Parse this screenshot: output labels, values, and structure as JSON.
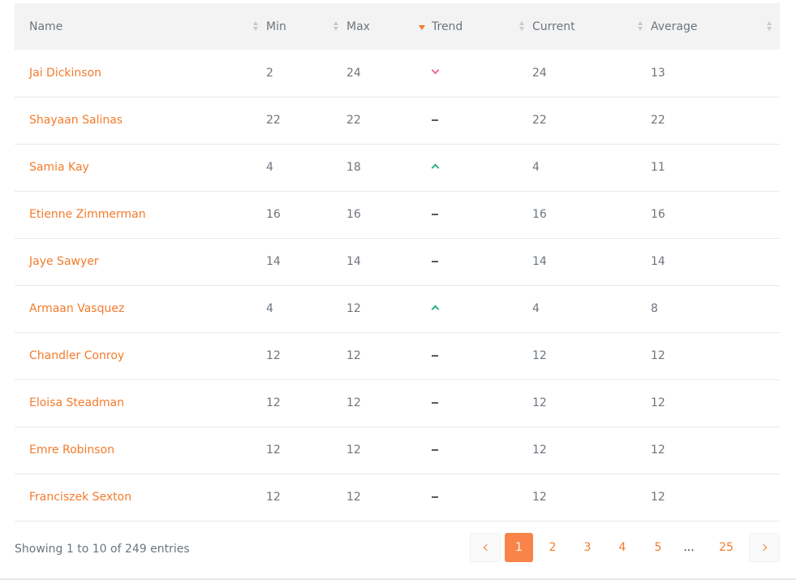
{
  "table": {
    "columns": [
      {
        "label": "Name",
        "sort": "none"
      },
      {
        "label": "Min",
        "sort": "none"
      },
      {
        "label": "Max",
        "sort": "desc"
      },
      {
        "label": "Trend",
        "sort": "none"
      },
      {
        "label": "Current",
        "sort": "none"
      },
      {
        "label": "Average",
        "sort": "none"
      }
    ],
    "rows": [
      {
        "name": "Jai Dickinson",
        "min": "2",
        "max": "24",
        "trend": "down",
        "current": "24",
        "average": "13"
      },
      {
        "name": "Shayaan Salinas",
        "min": "22",
        "max": "22",
        "trend": "flat",
        "current": "22",
        "average": "22"
      },
      {
        "name": "Samia Kay",
        "min": "4",
        "max": "18",
        "trend": "up",
        "current": "4",
        "average": "11"
      },
      {
        "name": "Etienne Zimmerman",
        "min": "16",
        "max": "16",
        "trend": "flat",
        "current": "16",
        "average": "16"
      },
      {
        "name": "Jaye Sawyer",
        "min": "14",
        "max": "14",
        "trend": "flat",
        "current": "14",
        "average": "14"
      },
      {
        "name": "Armaan Vasquez",
        "min": "4",
        "max": "12",
        "trend": "up",
        "current": "4",
        "average": "8"
      },
      {
        "name": "Chandler Conroy",
        "min": "12",
        "max": "12",
        "trend": "flat",
        "current": "12",
        "average": "12"
      },
      {
        "name": "Eloisa Steadman",
        "min": "12",
        "max": "12",
        "trend": "flat",
        "current": "12",
        "average": "12"
      },
      {
        "name": "Emre Robinson",
        "min": "12",
        "max": "12",
        "trend": "flat",
        "current": "12",
        "average": "12"
      },
      {
        "name": "Franciszek Sexton",
        "min": "12",
        "max": "12",
        "trend": "flat",
        "current": "12",
        "average": "12"
      }
    ]
  },
  "footer": {
    "info": "Showing 1 to 10 of 249 entries"
  },
  "pagination": {
    "prev_icon": "chevron-left-icon",
    "next_icon": "chevron-right-icon",
    "pages": [
      "1",
      "2",
      "3",
      "4",
      "5"
    ],
    "current": "1",
    "ellipsis": "...",
    "last": "25"
  },
  "colors": {
    "accent": "#f47b2c",
    "trend_down": "#f06e8f",
    "trend_up": "#2fb47c",
    "header_bg": "#f3f3f4"
  }
}
